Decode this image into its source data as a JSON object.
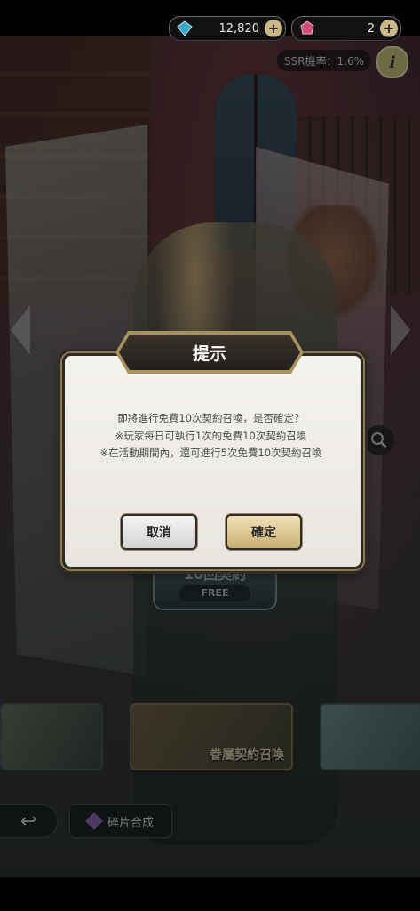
{
  "currency": {
    "gems": "12,820",
    "tickets": "2",
    "plus_symbol": "+"
  },
  "ssr_rate": "SSR機率：1.6%",
  "info_symbol": "i",
  "summon": {
    "title": "10回契約",
    "free_label": "FREE"
  },
  "banners": {
    "center_label": "眷屬契約召喚"
  },
  "bottom": {
    "back_symbol": "↩",
    "fragment_label": "碎片合成"
  },
  "dialog": {
    "title": "提示",
    "line1": "即將進行免費10次契約召喚，是否確定？",
    "line2": "※玩家每日可執行1次的免費10次契約召喚",
    "line3": "※在活動期間內，還可進行5次免費10次契約召喚",
    "cancel_label": "取消",
    "confirm_label": "確定"
  },
  "colors": {
    "gem": "#3aa8c8",
    "ticket": "#d04a7a",
    "confirm_button": "#c8ae72"
  }
}
